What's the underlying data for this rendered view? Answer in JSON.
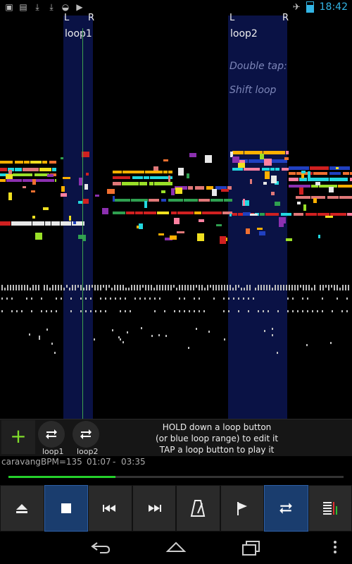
{
  "status_bar": {
    "time": "18:42",
    "battery_level": 0.7,
    "icons": [
      "sd-icon",
      "book-icon",
      "download-icon",
      "download-icon",
      "android-icon",
      "media-icon"
    ]
  },
  "loops": [
    {
      "name": "loop1",
      "left_marker": "L",
      "right_marker": "R"
    },
    {
      "name": "loop2",
      "left_marker": "L",
      "right_marker": "R"
    }
  ],
  "hints": {
    "line1": "Double tap:",
    "line2": "Shift loop"
  },
  "panel": {
    "add_label": "+",
    "loop_buttons": [
      {
        "label": "loop1"
      },
      {
        "label": "loop2"
      }
    ],
    "info": [
      "HOLD down a loop button",
      "(or blue loop range) to edit it",
      "TAP a loop button to play it"
    ]
  },
  "song": {
    "title": "caravang",
    "bpm": "BPM=135",
    "position": "01:07",
    "separator": "-",
    "duration": "03:35",
    "progress": 0.32
  },
  "toolbar": {
    "buttons": [
      {
        "name": "eject-button",
        "icon": "eject-icon",
        "active": false
      },
      {
        "name": "stop-button",
        "icon": "stop-icon",
        "active": true
      },
      {
        "name": "rewind-button",
        "icon": "rewind-icon",
        "active": false
      },
      {
        "name": "forward-button",
        "icon": "fast-forward-icon",
        "active": false
      },
      {
        "name": "metronome-button",
        "icon": "metronome-icon",
        "active": false
      },
      {
        "name": "marker-button",
        "icon": "flag-icon",
        "active": false
      },
      {
        "name": "loop-button",
        "icon": "repeat-icon",
        "active": true
      },
      {
        "name": "mixer-button",
        "icon": "mixer-icon",
        "active": false
      }
    ]
  },
  "navbar": [
    "back-icon",
    "home-icon",
    "recent-apps-icon",
    "menu-icon"
  ]
}
